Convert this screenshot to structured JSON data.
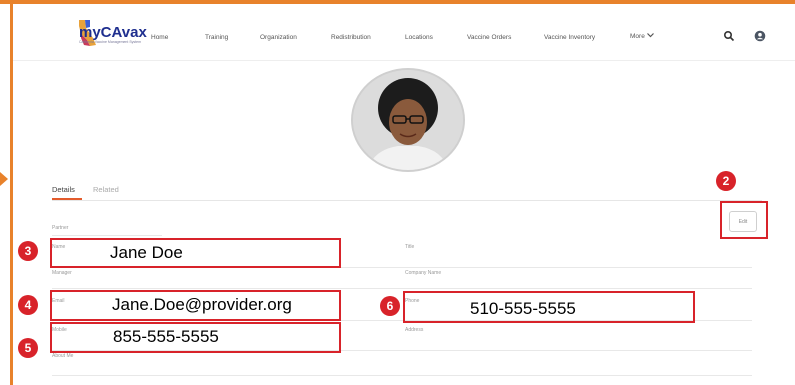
{
  "app": {
    "logo_text": "myCAvax",
    "logo_subtitle": "California Vaccine Management System"
  },
  "nav": {
    "items": [
      "Home",
      "Training",
      "Organization",
      "Redistribution",
      "Locations",
      "Vaccine Orders",
      "Vaccine Inventory"
    ],
    "more_label": "More"
  },
  "tabs": [
    "Details",
    "Related"
  ],
  "fields": {
    "partner_label": "Partner",
    "name_label": "Name",
    "name_value": "Jane Doe",
    "title_label": "Title",
    "manager_label": "Manager",
    "company_label": "Company Name",
    "email_label": "Email",
    "email_value": "Jane.Doe@provider.org",
    "phone_label": "Phone",
    "phone_value": "510-555-5555",
    "mobile_label": "Mobile",
    "mobile_value": "855-555-5555",
    "address_label": "Address",
    "about_label": "About Me"
  },
  "edit_label": "Edit",
  "markers": [
    "2",
    "3",
    "4",
    "5",
    "6"
  ],
  "colors": {
    "frame": "#e8822b",
    "highlight": "#d8232a",
    "active_tab": "#e35b2c",
    "logo_blue": "#1f2f8f"
  },
  "icons": [
    "california-logo-icon",
    "search-icon",
    "user-icon",
    "chevron-down-icon",
    "arrow-right-icon"
  ]
}
